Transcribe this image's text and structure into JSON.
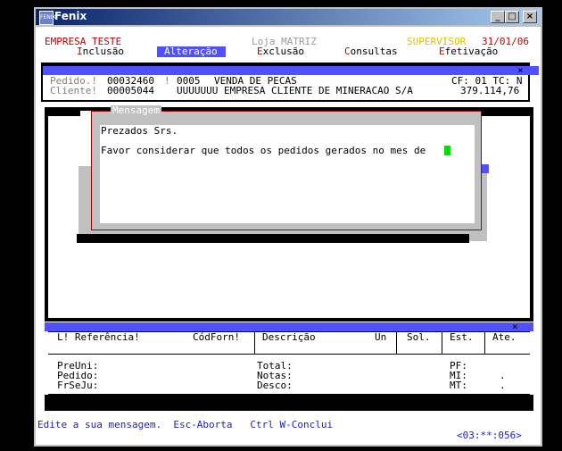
{
  "window": {
    "title": "Fenix",
    "icon_label": "FENIX",
    "minimize": "_",
    "maximize": "□",
    "close": "×"
  },
  "header": {
    "company": "EMPRESA TESTE",
    "store": "Loja MATRIZ",
    "user": "SUPERVISOR",
    "date": "31/01/06"
  },
  "menu": [
    {
      "hotkey": "I",
      "rest": "nclusão"
    },
    {
      "hotkey": "A",
      "rest": "lteração"
    },
    {
      "hotkey": "E",
      "rest": "xclusão"
    },
    {
      "hotkey": "C",
      "rest": "onsultas"
    },
    {
      "hotkey": "E",
      "rest": "fetivação"
    }
  ],
  "order": {
    "pedido_label": "Pedido.!",
    "pedido_value": "00032460",
    "sep": "!",
    "op_code": "0005",
    "op_desc": "VENDA DE PECAS",
    "cf_tc": "CF: 01 TC: N",
    "cliente_label": "Cliente!",
    "cliente_code": "00005044",
    "cliente_name": "UUUUUUU EMPRESA CLIENTE DE MINERACAO S/A",
    "total": "379.114,76"
  },
  "close_x": "×",
  "dialog": {
    "title": "Mensagem",
    "line1": "Prezados Srs.",
    "line2": "Favor considerar que todos os pedidos gerados no mes de"
  },
  "table": {
    "headers": [
      "L! Referência!",
      "CódForn!",
      "Descrição",
      "Un",
      "Sol.",
      "Est.",
      "Ate."
    ]
  },
  "details": {
    "left": [
      "PreUni:",
      "Pedido:",
      "FrSeJu:"
    ],
    "middle": [
      "Total:",
      "Notas:",
      "Desco:"
    ],
    "right": [
      "PF:",
      "MI:",
      "MT:"
    ],
    "right_values": [
      ".",
      "."
    ]
  },
  "status": {
    "hint": "Edite a sua mensagem.  Esc-Aborta   Ctrl W-Conclui",
    "position": "<03:**:056>"
  }
}
